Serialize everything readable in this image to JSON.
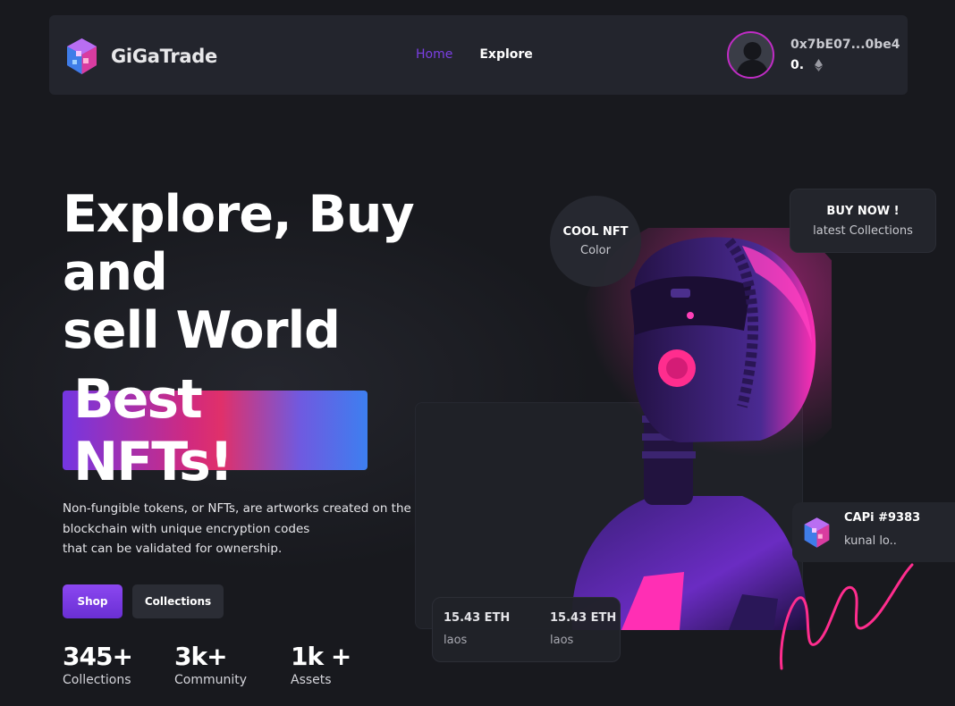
{
  "navbar": {
    "brand": "GiGaTrade",
    "links": [
      {
        "label": "Home",
        "active": true
      },
      {
        "label": "Explore",
        "active": false
      }
    ],
    "wallet_address": "0x7bE07...0be4",
    "wallet_balance": "0.",
    "balance_icon": "ethereum-icon"
  },
  "hero": {
    "title_lines": [
      "Explore, Buy",
      "and",
      "sell World"
    ],
    "highlight": "Best NFTs!",
    "description_lines": [
      "Non-fungible tokens, or NFTs, are artworks created on the",
      "blockchain with unique encryption codes",
      "that can be validated for ownership."
    ],
    "buttons": {
      "shop": "Shop",
      "collections": "Collections"
    },
    "stats": [
      {
        "value": "345+",
        "label": "Collections"
      },
      {
        "value": "3k+",
        "label": "Community"
      },
      {
        "value": "1k +",
        "label": "Assets"
      }
    ]
  },
  "visual": {
    "cool_badge": {
      "title": "COOL NFT",
      "subtitle": "Color"
    },
    "buy_card": {
      "title": "BUY NOW !",
      "subtitle": "latest Collections"
    },
    "capi_card": {
      "title": "CAPi #9383",
      "subtitle": "kunal lo.."
    },
    "eth_items": [
      {
        "value": "15.43 ETH",
        "label": "laos"
      },
      {
        "value": "15.43 ETH",
        "label": "laos"
      }
    ]
  },
  "colors": {
    "background": "#18191e",
    "navbar": "#23252d",
    "accent_purple": "#7b3fe4",
    "accent_pink": "#e0306a",
    "accent_blue": "#3d7ff0"
  }
}
